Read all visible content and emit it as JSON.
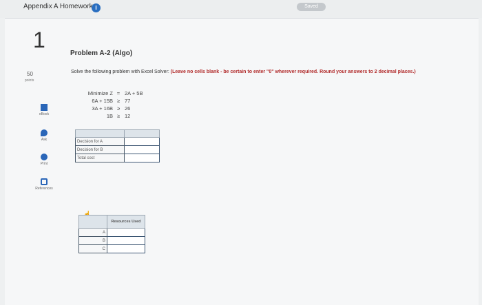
{
  "header": {
    "title": "Appendix A Homework",
    "info_icon": "info-icon",
    "saved_label": "Saved"
  },
  "question": {
    "number": "1",
    "points_value": "50",
    "points_label": "points"
  },
  "sidebar": {
    "items": [
      {
        "label": "eBook",
        "icon": "book-icon"
      },
      {
        "label": "Ask",
        "icon": "chat-icon"
      },
      {
        "label": "Print",
        "icon": "print-icon"
      },
      {
        "label": "References",
        "icon": "references-icon"
      }
    ]
  },
  "problem": {
    "title": "Problem A-2 (Algo)",
    "instruction": "Solve the following problem with Excel Solver:",
    "instruction_emphasis": "(Leave no cells blank - be certain to enter \"0\" wherever required. Round your answers to 2 decimal places.)"
  },
  "lp_model": {
    "lines": [
      {
        "lhs": "Minimize Z",
        "op": "=",
        "rhs": "2A + 5B"
      },
      {
        "lhs": "6A + 15B",
        "op": "≥",
        "rhs": "77"
      },
      {
        "lhs": "3A + 16B",
        "op": "≥",
        "rhs": "26"
      },
      {
        "lhs": "1B",
        "op": "≥",
        "rhs": "12"
      }
    ]
  },
  "decision_table": {
    "rows": [
      "Decision for A",
      "Decision for B",
      "Total cost"
    ]
  },
  "resources_table": {
    "header": "Resources Used",
    "rows": [
      "A",
      "B",
      "C"
    ]
  }
}
